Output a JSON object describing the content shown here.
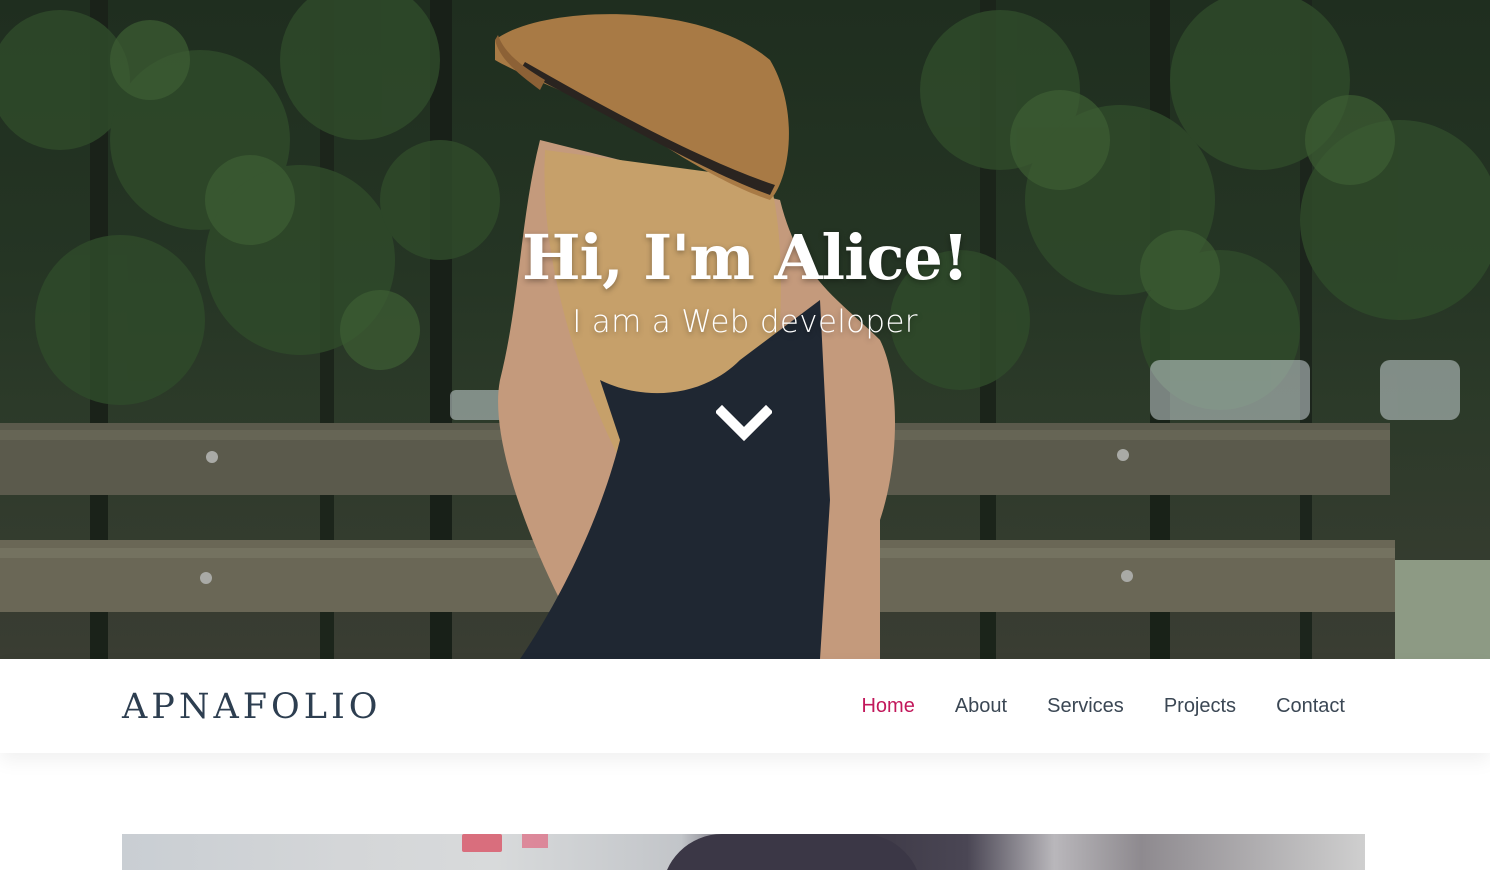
{
  "hero": {
    "title": "Hi, I'm Alice!",
    "subtitle": "I am a Web developer",
    "scroll_icon": "chevron-down-icon"
  },
  "navbar": {
    "brand": "APNAFOLIO",
    "links": [
      {
        "label": "Home",
        "active": true
      },
      {
        "label": "About",
        "active": false
      },
      {
        "label": "Services",
        "active": false
      },
      {
        "label": "Projects",
        "active": false
      },
      {
        "label": "Contact",
        "active": false
      }
    ]
  },
  "colors": {
    "accent": "#c2185b",
    "brand_text": "#2d3e50",
    "nav_text": "#3b4754"
  }
}
